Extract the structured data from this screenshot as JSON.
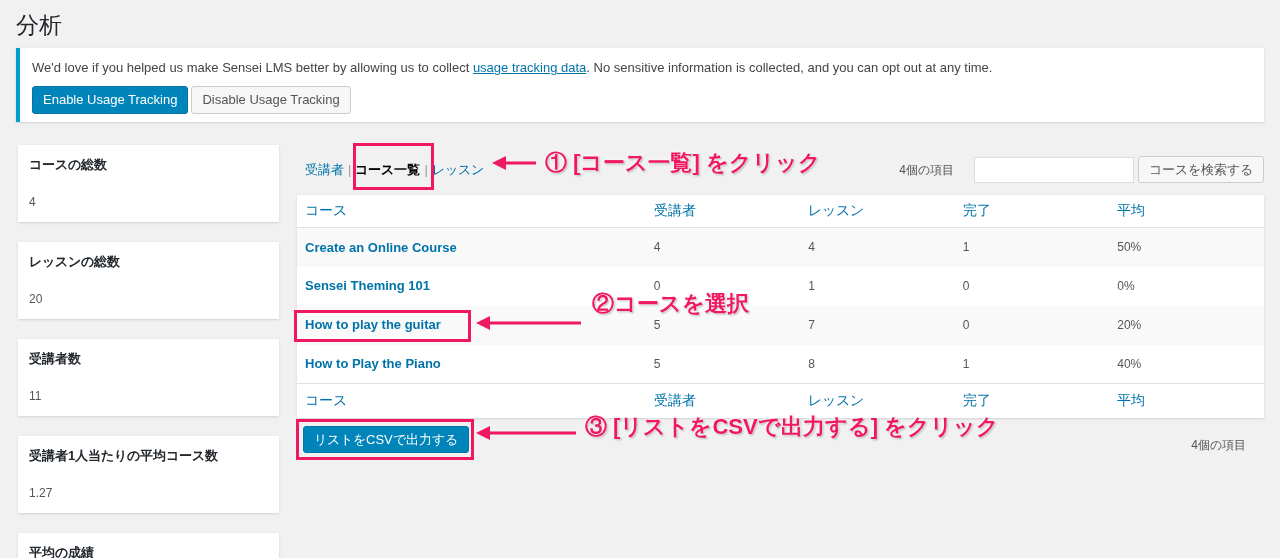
{
  "page_title": "分析",
  "notice": {
    "text_before": "We'd love if you helped us make Sensei LMS better by allowing us to collect ",
    "link": "usage tracking data",
    "text_after": ". No sensitive information is collected, and you can opt out at any time.",
    "buttons": [
      {
        "label": "Enable Usage Tracking",
        "kind": "primary"
      },
      {
        "label": "Disable Usage Tracking",
        "kind": "secondary"
      }
    ]
  },
  "stat_cards": [
    {
      "title": "コースの総数",
      "value": "4"
    },
    {
      "title": "レッスンの総数",
      "value": "20"
    },
    {
      "title": "受講者数",
      "value": "11"
    },
    {
      "title": "受講者1人当たりの平均コース数",
      "value": "1.27"
    },
    {
      "title": "平均の成績"
    }
  ],
  "tabs": [
    {
      "label": "受講者",
      "selected": false
    },
    {
      "label": "コース一覧",
      "selected": true
    },
    {
      "label": "レッスン",
      "selected": false
    }
  ],
  "tab_separators": [
    "|",
    "|"
  ],
  "item_count_top": "4個の項目",
  "search": {
    "button": "コースを検索する"
  },
  "table": {
    "columns": [
      "コース",
      "受講者",
      "レッスン",
      "完了",
      "平均"
    ],
    "rows": [
      [
        "Create an Online Course",
        "4",
        "4",
        "1",
        "50%"
      ],
      [
        "Sensei Theming 101",
        "0",
        "1",
        "0",
        "0%"
      ],
      [
        "How to play the guitar",
        "5",
        "7",
        "0",
        "20%"
      ],
      [
        "How to Play the Piano",
        "5",
        "8",
        "1",
        "40%"
      ]
    ],
    "footer_columns": [
      "コース",
      "受講者",
      "レッスン",
      "完了",
      "平均"
    ]
  },
  "export_button": "リストをCSVで出力する",
  "item_count_bottom": "4個の項目",
  "annotations": [
    "① [コース一覧] をクリック",
    "②コースを選択",
    "③ [リストをCSVで出力する] をクリック"
  ]
}
